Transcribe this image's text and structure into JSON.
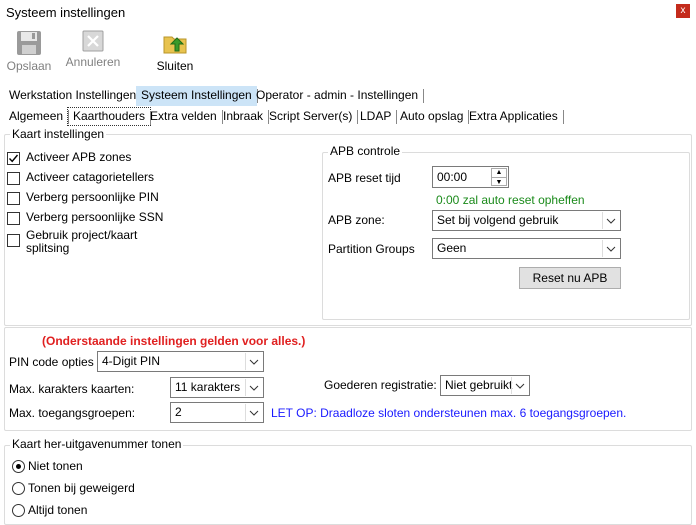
{
  "window": {
    "title": "Systeem instellingen",
    "close_glyph": "x"
  },
  "toolbar": {
    "save_label": "Opslaan",
    "cancel_label": "Annuleren",
    "close_label": "Sluiten"
  },
  "tabs_main": [
    "Werkstation Instellingen",
    "Systeem Instellingen",
    "Operator - admin - Instellingen"
  ],
  "tabs_sub": [
    "Algemeen",
    "Kaarthouders",
    "Extra velden",
    "Inbraak",
    "Script Server(s)",
    "LDAP",
    "Auto opslag",
    "Extra Applicaties"
  ],
  "card_settings": {
    "legend": "Kaart instellingen",
    "checkboxes": [
      {
        "label": "Activeer APB zones",
        "checked": true
      },
      {
        "label": "Activeer catagorietellers",
        "checked": false
      },
      {
        "label": "Verberg persoonlijke PIN",
        "checked": false
      },
      {
        "label": "Verberg persoonlijke SSN",
        "checked": false
      },
      {
        "label": "Gebruik project/kaart splitsing",
        "checked": false
      }
    ]
  },
  "apb": {
    "legend": "APB controle",
    "reset_time_label": "APB reset tijd",
    "reset_time_value": "00:00",
    "reset_hint": "0:00 zal auto reset opheffen",
    "zone_label": "APB zone:",
    "zone_value": "Set bij volgend gebruik",
    "partition_label": "Partition Groups",
    "partition_value": "Geen",
    "reset_button": "Reset nu APB"
  },
  "general": {
    "notice": "(Onderstaande instellingen gelden voor alles.)",
    "pin_label": "PIN  code opties",
    "pin_value": "4-Digit PIN",
    "max_chars_label": "Max. karakters kaarten:",
    "max_chars_value": "11 karakters",
    "goods_label": "Goederen registratie:",
    "goods_value": "Niet gebruikt",
    "max_groups_label": "Max. toegangsgroepen:",
    "max_groups_value": "2",
    "wireless_note": "LET OP: Draadloze sloten ondersteunen max. 6 toegangsgroepen."
  },
  "reissue": {
    "legend": "Kaart her-uitgavenummer tonen",
    "options": [
      {
        "label": "Niet tonen",
        "selected": true
      },
      {
        "label": "Tonen bij geweigerd",
        "selected": false
      },
      {
        "label": "Altijd tonen",
        "selected": false
      }
    ]
  },
  "colors": {
    "notice": "#e02020",
    "hint": "#1a8a1a",
    "note": "#1a1aff",
    "tab_selected": "#cce4f7",
    "close": "#c42b1c"
  }
}
